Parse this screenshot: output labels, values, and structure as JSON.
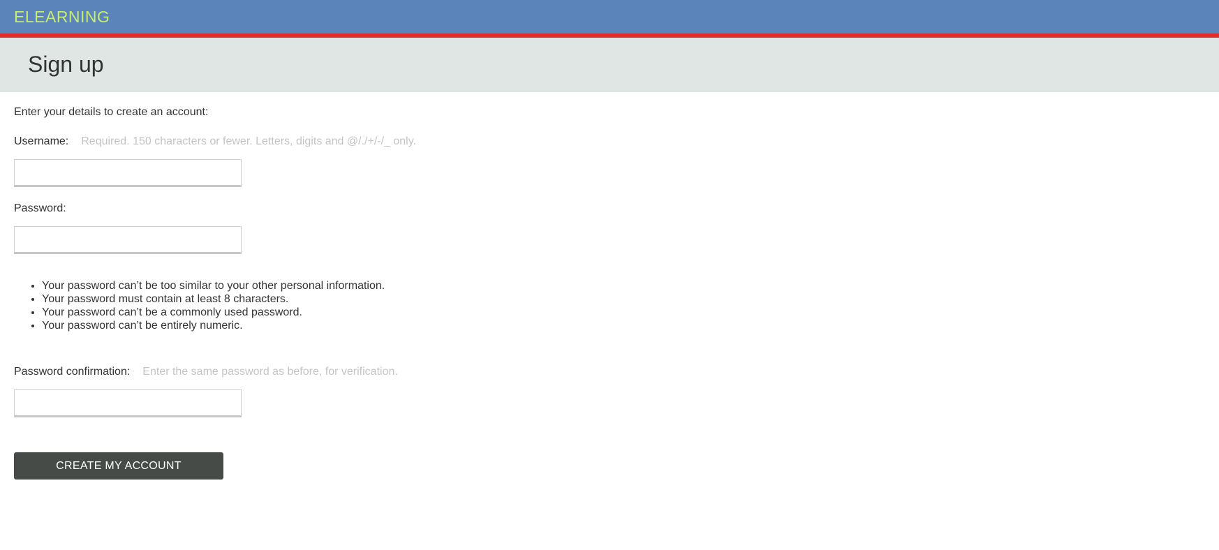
{
  "header": {
    "brand": "ELEARNING"
  },
  "page": {
    "title": "Sign up"
  },
  "form": {
    "intro": "Enter your details to create an account:",
    "username": {
      "label": "Username:",
      "help": "Required. 150 characters or fewer. Letters, digits and @/./+/-/_ only.",
      "value": ""
    },
    "password": {
      "label": "Password:",
      "value": "",
      "rules": [
        "Your password can’t be too similar to your other personal information.",
        "Your password must contain at least 8 characters.",
        "Your password can’t be a commonly used password.",
        "Your password can’t be entirely numeric."
      ]
    },
    "password_confirmation": {
      "label": "Password confirmation:",
      "help": "Enter the same password as before, for verification.",
      "value": ""
    },
    "submit_label": "CREATE MY ACCOUNT"
  },
  "colors": {
    "header_bg": "#5b84bb",
    "header_accent": "#e12c2c",
    "brand_text": "#c7ec6e",
    "title_bg": "#e0e6e4",
    "button_bg": "#474b48"
  }
}
